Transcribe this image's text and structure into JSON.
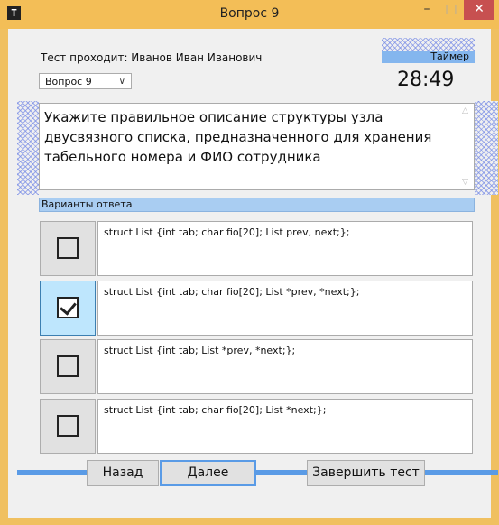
{
  "window": {
    "title": "Вопрос 9",
    "icon": "app-icon-T"
  },
  "header": {
    "student_label": "Тест проходит: Иванов Иван Иванович",
    "question_select": "Вопрос 9",
    "timer_label": "Таймер",
    "timer_value": "28:49"
  },
  "question": {
    "text": "Укажите правильное описание структуры узла двусвязного списка, предназначенного для хранения табельного номера и ФИО сотрудника"
  },
  "answers": {
    "header": "Варианты ответа",
    "options": [
      {
        "text": "struct List {int tab; char fio[20]; List prev, next;};",
        "checked": false
      },
      {
        "text": "struct List {int tab; char fio[20]; List *prev, *next;};",
        "checked": true
      },
      {
        "text": "struct List {int tab; List *prev, *next;};",
        "checked": false
      },
      {
        "text": "struct List {int tab; char fio[20]; List *next;};",
        "checked": false
      }
    ]
  },
  "buttons": {
    "back": "Назад",
    "next": "Далее",
    "finish": "Завершить тест"
  },
  "colors": {
    "title_bar": "#f3be57",
    "accent_blue": "#5a9be6",
    "close": "#c75050"
  }
}
